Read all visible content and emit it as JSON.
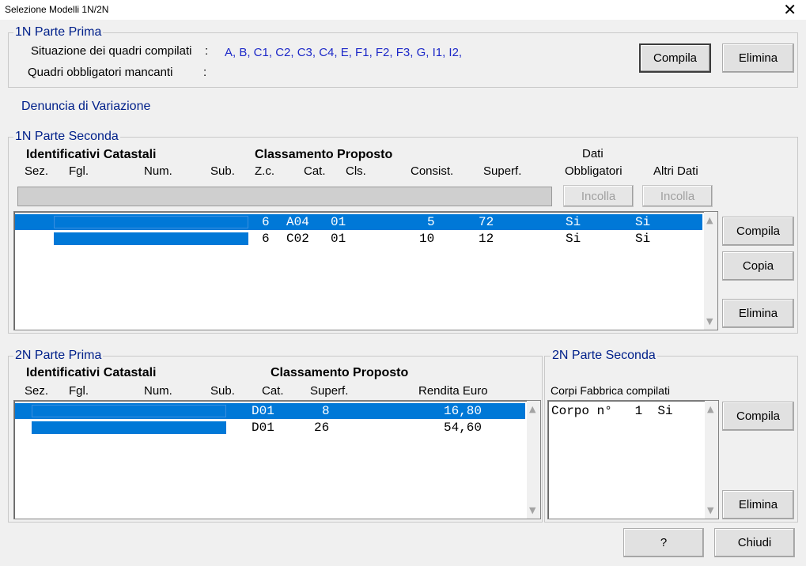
{
  "window": {
    "title": "Selezione Modelli 1N/2N",
    "close_glyph": "✕"
  },
  "p1n_prima": {
    "title": "1N Parte Prima",
    "situazione_label": "Situazione dei quadri compilati",
    "colon": ":",
    "situazione_value": "A, B, C1, C2, C3, C4, E, F1, F2, F3, G, I1, I2,",
    "mancanti_label": "Quadri obbligatori mancanti",
    "mancanti_colon": ":",
    "compila": "Compila",
    "elimina": "Elimina"
  },
  "denuncia": "Denuncia di Variazione",
  "p1n_seconda": {
    "title": "1N Parte Seconda",
    "h_ident": "Identificativi Catastali",
    "h_class": "Classamento Proposto",
    "h_dati": "Dati",
    "cols": {
      "sez": "Sez.",
      "fgl": "Fgl.",
      "num": "Num.",
      "sub": "Sub.",
      "zc": "Z.c.",
      "cat": "Cat.",
      "cls": "Cls.",
      "consist": "Consist.",
      "superf": "Superf.",
      "obbl": "Obbligatori",
      "altri": "Altri Dati"
    },
    "incolla1": "Incolla",
    "incolla2": "Incolla",
    "rows": [
      {
        "zc": "6",
        "cat": "A04",
        "cls": "01",
        "consist": "5",
        "superf": "72",
        "obbl": "Si",
        "altri": "Si"
      },
      {
        "zc": "6",
        "cat": "C02",
        "cls": "01",
        "consist": "10",
        "superf": "12",
        "obbl": "Si",
        "altri": "Si"
      }
    ],
    "compila": "Compila",
    "copia": "Copia",
    "elimina": "Elimina"
  },
  "p2n_prima": {
    "title": "2N Parte Prima",
    "h_ident": "Identificativi Catastali",
    "h_class": "Classamento Proposto",
    "cols": {
      "sez": "Sez.",
      "fgl": "Fgl.",
      "num": "Num.",
      "sub": "Sub.",
      "cat": "Cat.",
      "superf": "Superf.",
      "rendita": "Rendita Euro"
    },
    "rows": [
      {
        "cat": "D01",
        "superf": "8",
        "rendita": "16,80"
      },
      {
        "cat": "D01",
        "superf": "26",
        "rendita": "54,60"
      }
    ]
  },
  "p2n_seconda": {
    "title": "2N Parte Seconda",
    "corpi_label": "Corpi Fabbrica compilati",
    "items": [
      {
        "text": "Corpo n°   1  Si"
      }
    ],
    "compila": "Compila",
    "elimina": "Elimina"
  },
  "footer": {
    "help": "?",
    "chiudi": "Chiudi"
  },
  "icons": {
    "scroll_up": "▲",
    "scroll_down": "▼"
  },
  "colors": {
    "selection": "#0078d7",
    "group_title": "#00208a",
    "value_blue": "#1c28c8"
  }
}
